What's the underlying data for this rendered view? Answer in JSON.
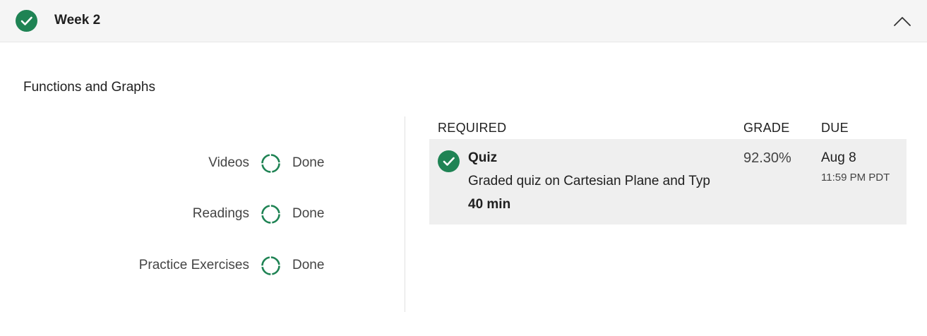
{
  "week": {
    "title": "Week 2",
    "status_icon": "check-circle-icon",
    "collapse_icon": "chevron-up-icon"
  },
  "module": {
    "title": "Functions and Graphs"
  },
  "progress": [
    {
      "label": "Videos",
      "status": "Done"
    },
    {
      "label": "Readings",
      "status": "Done"
    },
    {
      "label": "Practice Exercises",
      "status": "Done"
    }
  ],
  "assignments": {
    "headers": {
      "required": "REQUIRED",
      "grade": "GRADE",
      "due": "DUE"
    },
    "items": [
      {
        "type": "Quiz",
        "name": "Graded quiz on Cartesian Plane and Typ",
        "duration": "40 min",
        "grade": "92.30%",
        "due_date": "Aug 8",
        "due_time": "11:59 PM PDT"
      }
    ]
  },
  "colors": {
    "accent_green": "#1f8354",
    "header_bg": "#f5f5f5",
    "row_bg": "#efefef"
  }
}
